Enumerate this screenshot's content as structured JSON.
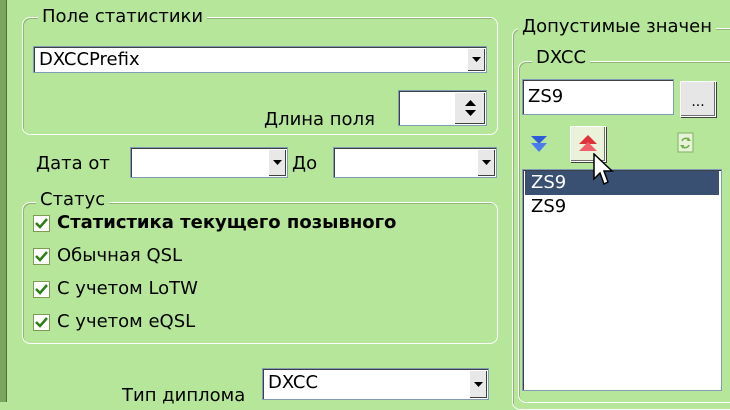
{
  "stats_field": {
    "legend": "Поле статистики",
    "value": "DXCCPrefix",
    "length_label": "Длина поля",
    "length_value": ""
  },
  "date": {
    "from_label": "Дата от",
    "to_label": "До",
    "from_value": "",
    "to_value": ""
  },
  "status": {
    "legend": "Статус",
    "items": [
      {
        "label": "Статистика текущего позывного",
        "checked": true,
        "bold": true
      },
      {
        "label": "Обычная QSL",
        "checked": true,
        "bold": false
      },
      {
        "label": "С учетом LoTW",
        "checked": true,
        "bold": false
      },
      {
        "label": "С учетом eQSL",
        "checked": true,
        "bold": false
      }
    ]
  },
  "diploma": {
    "label": "Тип диплома",
    "value": "DXCC"
  },
  "allowed": {
    "legend": "Допустимые значен",
    "sub_legend": "DXCC",
    "input_value": "ZS9",
    "browse_label": "...",
    "list_items": [
      {
        "text": "ZS9",
        "selected": true
      },
      {
        "text": "ZS9",
        "selected": false
      }
    ]
  },
  "colors": {
    "background": "#b5e69a",
    "selection": "#3a5072",
    "check": "#2e7d16"
  }
}
